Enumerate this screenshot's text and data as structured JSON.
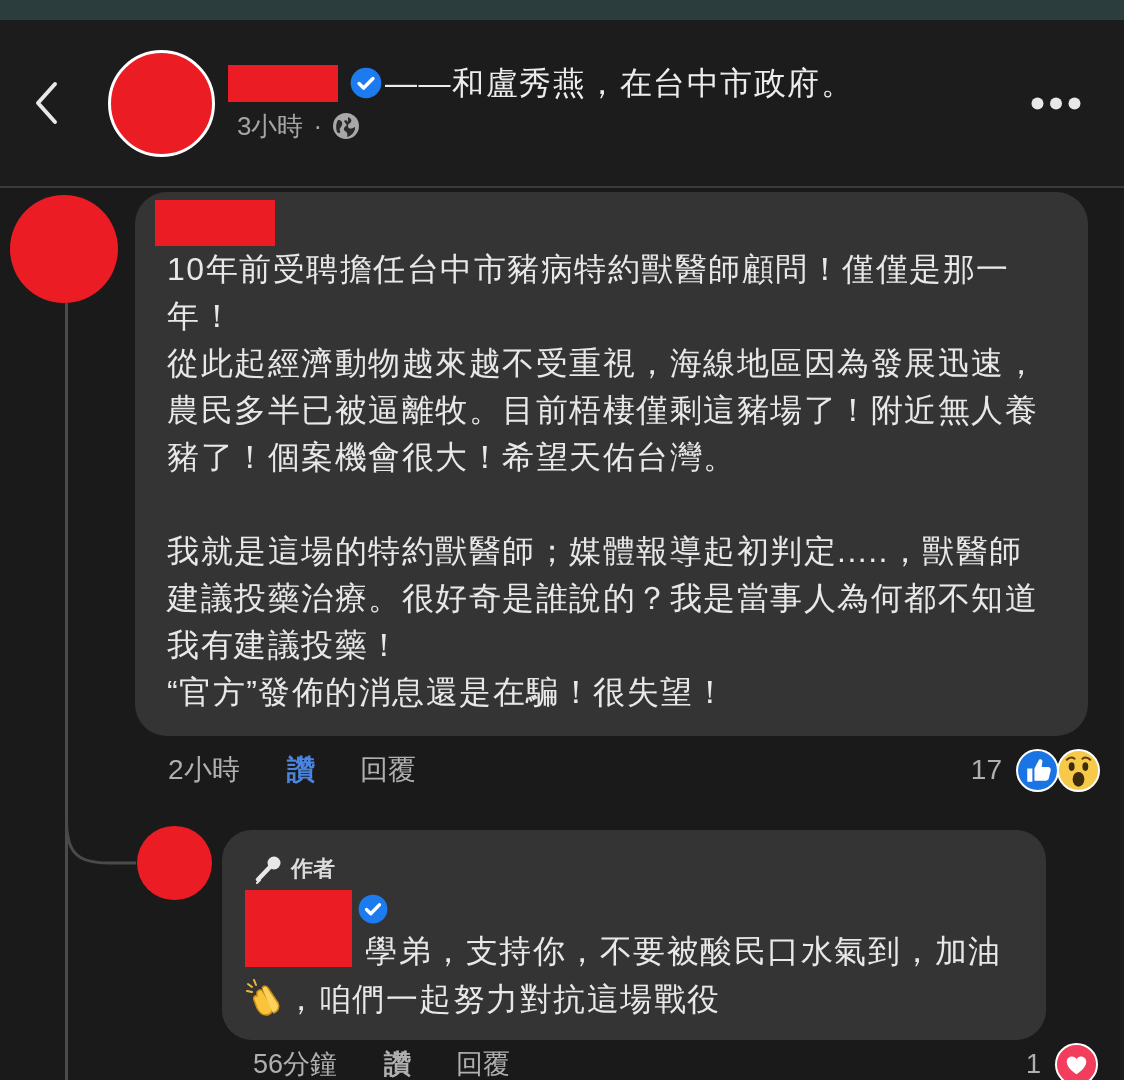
{
  "header": {
    "name_redacted": true,
    "verified": true,
    "title": "——和盧秀燕，在台中市政府。",
    "time": "3小時",
    "separator": "·"
  },
  "comment": {
    "name_redacted": true,
    "blocks": [
      {
        "paragraphs": [
          "10年前受聘擔任台中市豬病特約獸醫師顧問！僅僅是那一年！",
          "從此起經濟動物越來越不受重視，海線地區因為發展迅速，農民多半已被逼離牧。目前梧棲僅剩這豬場了！附近無人養豬了！個案機會很大！希望天佑台灣。"
        ]
      },
      {
        "paragraphs": [
          "我就是這場的特約獸醫師；媒體報導起初判定.....，獸醫師建議投藥治療。很好奇是誰說的？我是當事人為何都不知道我有建議投藥！",
          "“官方”發佈的消息還是在騙！很失望！"
        ]
      }
    ],
    "time": "2小時",
    "like_label": "讚",
    "liked": true,
    "reply_label": "回覆",
    "reaction_count": "17",
    "reactions": [
      {
        "kind": "like"
      },
      {
        "kind": "wow"
      }
    ]
  },
  "reply": {
    "badge": "作者",
    "name_redacted": true,
    "verified": true,
    "segments": [
      {
        "kind": "text",
        "text": "學弟，支持你，不要被酸民口水氣到，加油"
      },
      {
        "kind": "clap"
      },
      {
        "kind": "text",
        "text": "，咱們一起努力對抗這場戰役"
      }
    ],
    "time": "56分鐘",
    "like_label": "讚",
    "liked": false,
    "reply_label": "回覆",
    "reaction_count": "1",
    "reactions": [
      {
        "kind": "love"
      }
    ]
  }
}
